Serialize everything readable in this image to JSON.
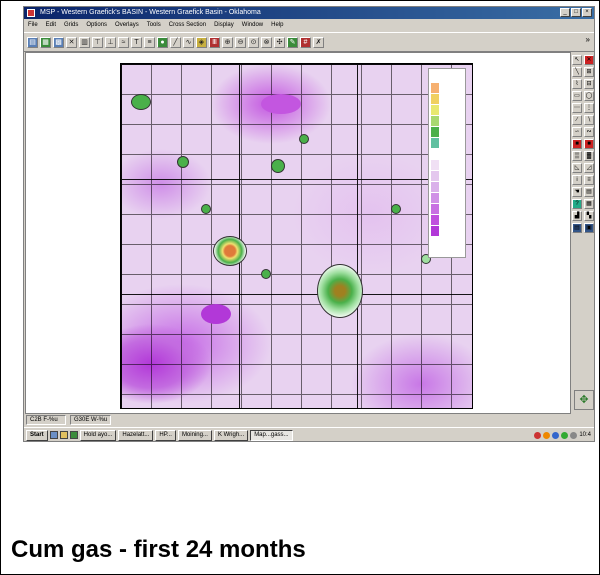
{
  "window": {
    "title": "MSP - Western Graefick's BASIN - Western Graefick Basin - Oklahoma",
    "buttons": [
      "_",
      "□",
      "×"
    ]
  },
  "menu": [
    "File",
    "Edit",
    "Grids",
    "Options",
    "Overlays",
    "Tools",
    "Cross Section",
    "Display",
    "Window",
    "Help"
  ],
  "toolbar": {
    "overflow": "»"
  },
  "status": {
    "left": "C2B F-%u",
    "right": "G30E W-%u"
  },
  "taskbar": {
    "start": "Start",
    "tasks": [
      "Hold ayo...",
      "Hazelatt...",
      "HP...",
      "Moining...",
      "K Wrigh...",
      "Map...gass..."
    ],
    "tray_time": "10:4"
  },
  "caption": "Cum gas - first 24 months",
  "colors": {
    "low": "#c860e0",
    "mid": "#e8d2f0",
    "high": "#4ab04a",
    "peak": "#e07a3a"
  }
}
